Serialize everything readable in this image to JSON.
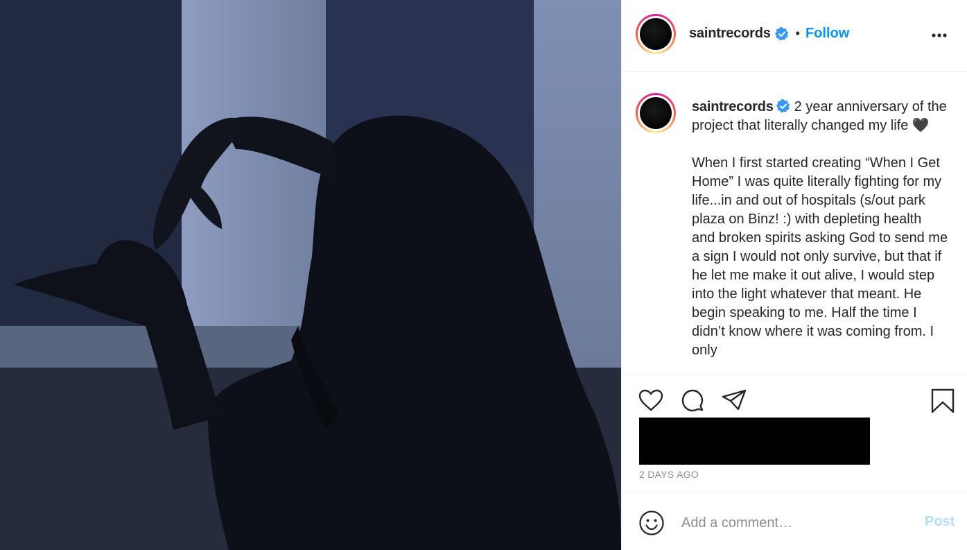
{
  "post": {
    "username": "saintrecords",
    "follow_label": "Follow",
    "separator": "•",
    "verified_icon": "verified-badge-icon"
  },
  "caption": {
    "username": "saintrecords",
    "first_line": "2 year anniversary of the project that literally changed my life 🖤",
    "body": "When I first started creating “When I Get Home” I was quite literally fighting for my life...in and out of hospitals (s/out park plaza on Binz! :) with depleting health and broken spirits asking God to send me a sign I would not only survive, but that if he let me make it out alive, I would step into the light whatever that meant. He begin speaking to me. Half the time I didn’t know where it was coming from. I only"
  },
  "actions": {
    "icons": [
      "heart-icon",
      "comment-icon",
      "share-icon",
      "bookmark-icon"
    ]
  },
  "timestamp": "2 DAYS AGO",
  "comment": {
    "placeholder": "Add a comment…",
    "post_label": "Post"
  },
  "colors": {
    "accent": "#0095f6",
    "post_disabled": "#b2dffc",
    "verified": "#3897f0"
  }
}
